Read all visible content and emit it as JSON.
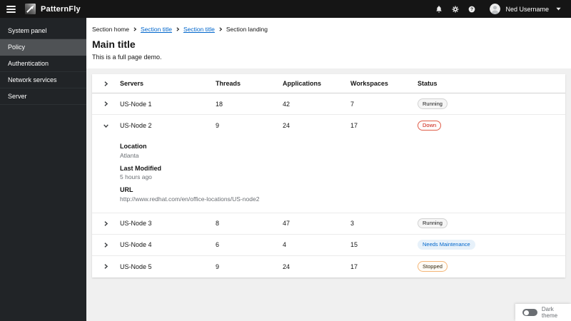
{
  "masthead": {
    "brand": "PatternFly",
    "user_name": "Ned Username"
  },
  "sidebar": {
    "items": [
      {
        "label": "System panel",
        "selected": false
      },
      {
        "label": "Policy",
        "selected": true
      },
      {
        "label": "Authentication",
        "selected": false
      },
      {
        "label": "Network services",
        "selected": false
      },
      {
        "label": "Server",
        "selected": false
      }
    ]
  },
  "breadcrumb": {
    "items": [
      {
        "label": "Section home",
        "type": "text"
      },
      {
        "label": "Section title",
        "type": "link"
      },
      {
        "label": "Section title",
        "type": "link"
      },
      {
        "label": "Section landing",
        "type": "text"
      }
    ]
  },
  "page": {
    "title": "Main title",
    "description": "This is a full page demo."
  },
  "table": {
    "columns": [
      "Servers",
      "Threads",
      "Applications",
      "Workspaces",
      "Status"
    ],
    "rows": [
      {
        "name": "US-Node 1",
        "threads": "18",
        "applications": "42",
        "workspaces": "7",
        "status": "Running",
        "status_variant": "grey",
        "expanded": false
      },
      {
        "name": "US-Node 2",
        "threads": "9",
        "applications": "24",
        "workspaces": "17",
        "status": "Down",
        "status_variant": "red-outline",
        "expanded": true,
        "details": [
          {
            "label": "Location",
            "value": "Atlanta"
          },
          {
            "label": "Last Modified",
            "value": "5 hours ago"
          },
          {
            "label": "URL",
            "value": "http://www.redhat.com/en/office-locations/US-node2"
          }
        ]
      },
      {
        "name": "US-Node 3",
        "threads": "8",
        "applications": "47",
        "workspaces": "3",
        "status": "Running",
        "status_variant": "grey",
        "expanded": false
      },
      {
        "name": "US-Node 4",
        "threads": "6",
        "applications": "4",
        "workspaces": "15",
        "status": "Needs Maintenance",
        "status_variant": "blue",
        "expanded": false
      },
      {
        "name": "US-Node 5",
        "threads": "9",
        "applications": "24",
        "workspaces": "17",
        "status": "Stopped",
        "status_variant": "orange-outline",
        "expanded": false
      }
    ]
  },
  "theme_toggle": {
    "label": "Dark theme",
    "enabled": false
  },
  "colors": {
    "masthead_bg": "#151515",
    "sidebar_bg": "#212427",
    "sidebar_selected_bg": "#4f5255",
    "page_bg": "#f0f0f0",
    "link": "#0066cc",
    "text": "#151515",
    "text_secondary": "#6a6e73",
    "status_running_bg": "#f5f5f5",
    "status_down": "#c9190b",
    "status_maintenance_bg": "#e7f1fa",
    "status_maintenance_text": "#0066cc",
    "status_stopped_border": "#f4b678"
  }
}
